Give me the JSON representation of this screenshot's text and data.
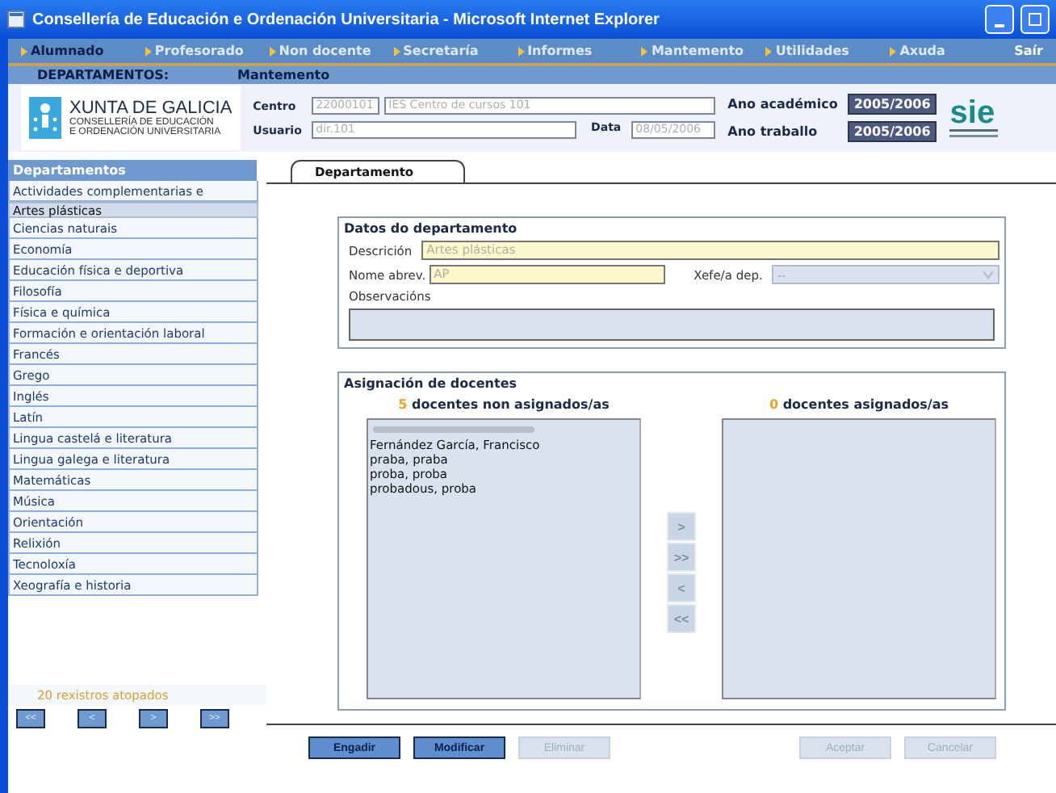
{
  "window": {
    "title": "Consellería de Educación e Ordenación Universitaria  - Microsoft Internet Explorer"
  },
  "menu": [
    {
      "label": "Alumnado",
      "selected": true
    },
    {
      "label": "Profesorado",
      "selected": false
    },
    {
      "label": "Non docente",
      "selected": false
    },
    {
      "label": "Secretaría",
      "selected": false
    },
    {
      "label": "Informes",
      "selected": false
    },
    {
      "label": "Mantemento",
      "selected": false
    },
    {
      "label": "Utilidades",
      "selected": false
    },
    {
      "label": "Axuda",
      "selected": false
    }
  ],
  "exit": "Saír",
  "breadcrumb": {
    "section": "DEPARTAMENTOS:",
    "mode": "Mantemento"
  },
  "header": {
    "logo_title": "XUNTA DE GALICIA",
    "logo_line1": "CONSELLERÍA DE EDUCACIÓN",
    "logo_line2": "E ORDENACIÓN UNIVERSITARIA",
    "centro_label": "Centro",
    "centro_code": "22000101",
    "centro_name": "IES Centro de cursos 101",
    "usuario_label": "Usuario",
    "usuario": "dir.101",
    "data_label": "Data",
    "data": "08/05/2006",
    "ano_academico_label": "Ano académico",
    "ano_academico": "2005/2006",
    "ano_traballo_label": "Ano traballo",
    "ano_traballo": "2005/2006",
    "brand": "sie"
  },
  "sidebar": {
    "title": "Departamentos",
    "items": [
      {
        "label": "Actividades complementarias e",
        "selected": false
      },
      {
        "label": "Artes plásticas",
        "selected": true
      },
      {
        "label": "Ciencias naturais",
        "selected": false
      },
      {
        "label": "Economía",
        "selected": false
      },
      {
        "label": "Educación física e deportiva",
        "selected": false
      },
      {
        "label": "Filosofía",
        "selected": false
      },
      {
        "label": "Física e química",
        "selected": false
      },
      {
        "label": "Formación e orientación laboral",
        "selected": false
      },
      {
        "label": "Francés",
        "selected": false
      },
      {
        "label": "Grego",
        "selected": false
      },
      {
        "label": "Inglés",
        "selected": false
      },
      {
        "label": "Latín",
        "selected": false
      },
      {
        "label": "Lingua castelá e literatura",
        "selected": false
      },
      {
        "label": "Lingua galega e literatura",
        "selected": false
      },
      {
        "label": "Matemáticas",
        "selected": false
      },
      {
        "label": "Música",
        "selected": false
      },
      {
        "label": "Orientación",
        "selected": false
      },
      {
        "label": "Relixión",
        "selected": false
      },
      {
        "label": "Tecnoloxía",
        "selected": false
      },
      {
        "label": "Xeografía e historia",
        "selected": false
      }
    ],
    "count": "20 rexistros atopados",
    "pager": [
      "<<",
      "<",
      ">",
      ">>"
    ]
  },
  "tabs": [
    {
      "label": "Departamento",
      "selected": true
    }
  ],
  "datos": {
    "legend": "Datos do departamento",
    "descricion_label": "Descrición",
    "descricion": "Artes plásticas",
    "abrev_label": "Nome abrev.",
    "abrev": "AP",
    "xefe_label": "Xefe/a dep.",
    "xefe": "--",
    "observacions_label": "Observacións"
  },
  "asignacion": {
    "legend": "Asignación de docentes",
    "left_count": "5",
    "left_title": "docentes non asignados/as",
    "right_count": "0",
    "right_title": "docentes asignados/as",
    "unassigned": [
      {
        "kind": "blurred"
      },
      {
        "kind": "name",
        "label": "Fernández García, Francisco"
      },
      {
        "kind": "name",
        "label": "praba, praba"
      },
      {
        "kind": "name",
        "label": "proba, proba"
      },
      {
        "kind": "name",
        "label": "probadous, proba"
      }
    ],
    "transfer": [
      {
        "label": ">",
        "disabled": true
      },
      {
        "label": ">>",
        "disabled": true
      },
      {
        "label": "<",
        "disabled": true
      },
      {
        "label": "<<",
        "disabled": true
      }
    ]
  },
  "buttons": [
    {
      "label": "Engadir",
      "disabled": false
    },
    {
      "label": "Modificar",
      "disabled": false
    },
    {
      "label": "Eliminar",
      "disabled": true
    },
    {
      "label": "Aceptar",
      "disabled": true
    },
    {
      "label": "Cancelar",
      "disabled": true
    }
  ]
}
